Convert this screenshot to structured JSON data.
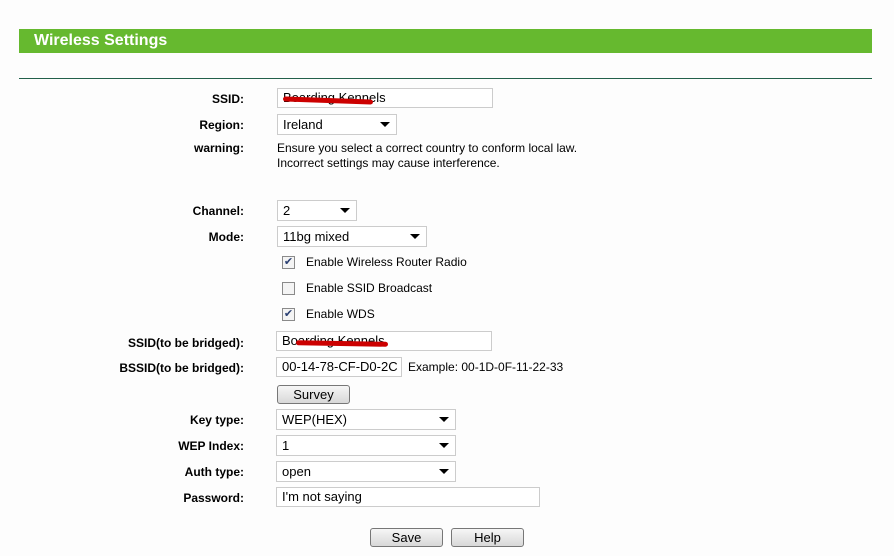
{
  "header": {
    "title": "Wireless Settings"
  },
  "form": {
    "ssid": {
      "label": "SSID:",
      "value": "Boarding Kennels"
    },
    "region": {
      "label": "Region:",
      "value": "Ireland"
    },
    "warning": {
      "label": "warning:",
      "line1": "Ensure you select a correct country to conform local law.",
      "line2": "Incorrect settings may cause interference."
    },
    "channel": {
      "label": "Channel:",
      "value": "2"
    },
    "mode": {
      "label": "Mode:",
      "value": "11bg mixed"
    },
    "checkboxes": [
      {
        "label": "Enable Wireless Router Radio",
        "checked": true
      },
      {
        "label": "Enable SSID Broadcast",
        "checked": false
      },
      {
        "label": "Enable WDS",
        "checked": true
      }
    ],
    "bridged_ssid": {
      "label": "SSID(to be bridged):",
      "value": "Boarding Kennels"
    },
    "bridged_bssid": {
      "label": "BSSID(to be bridged):",
      "value": "00-14-78-CF-D0-2C",
      "example": "Example: 00-1D-0F-11-22-33"
    },
    "survey_label": "Survey",
    "key_type": {
      "label": "Key type:",
      "value": "WEP(HEX)"
    },
    "wep_index": {
      "label": "WEP Index:",
      "value": "1"
    },
    "auth_type": {
      "label": "Auth type:",
      "value": "open"
    },
    "password": {
      "label": "Password:",
      "value": "I'm not saying"
    }
  },
  "buttons": {
    "save": "Save",
    "help": "Help"
  },
  "colors": {
    "header": "#66b92f",
    "redaction": "#cc0000"
  }
}
